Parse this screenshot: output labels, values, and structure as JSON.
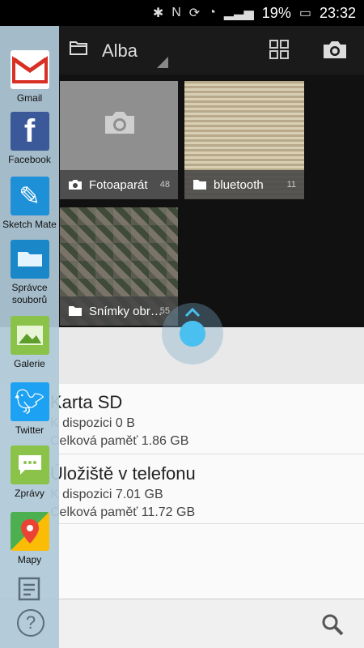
{
  "status": {
    "battery": "19%",
    "time": "23:32"
  },
  "toolbar": {
    "title": "Alba"
  },
  "albums": [
    {
      "name": "Fotoaparát",
      "count": "48"
    },
    {
      "name": "bluetooth",
      "count": "11"
    },
    {
      "name": "Snímky obr…",
      "count": "55"
    }
  ],
  "storage": [
    {
      "title": "Karta SD",
      "free": "K dispozici 0 B",
      "total": "Celková paměť 1.86 GB"
    },
    {
      "title": "Úložiště v telefonu",
      "free": "K dispozici 7.01 GB",
      "total": "Celková paměť 11.72 GB"
    }
  ],
  "apps": [
    {
      "label": "Gmail",
      "icon": "gmail-icon",
      "color": "#ffffff"
    },
    {
      "label": "Facebook",
      "icon": "facebook-icon",
      "color": "#3b5998"
    },
    {
      "label": "Sketch Mate",
      "icon": "feather-icon",
      "color": "#1e90d8"
    },
    {
      "label": "Správce souborů",
      "icon": "folder-icon",
      "color": "#1a88c8"
    },
    {
      "label": "Galerie",
      "icon": "gallery-icon",
      "color": "#8bc34a"
    },
    {
      "label": "Twitter",
      "icon": "twitter-icon",
      "color": "#1da1f2"
    },
    {
      "label": "Zprávy",
      "icon": "message-icon",
      "color": "#8bc34a"
    },
    {
      "label": "Mapy",
      "icon": "maps-icon",
      "color": "#4caf50"
    }
  ]
}
